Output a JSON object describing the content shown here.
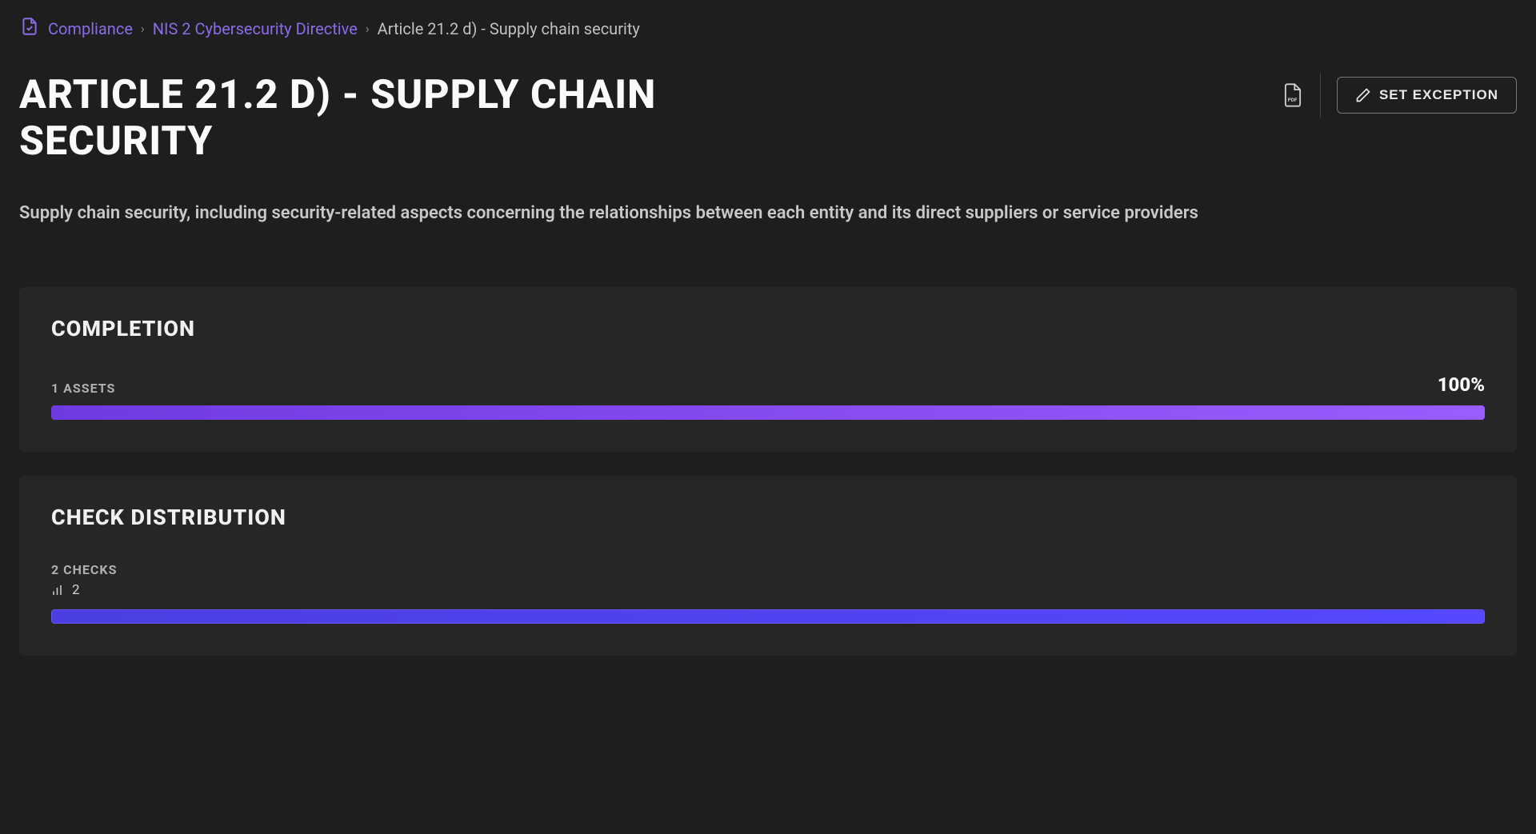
{
  "breadcrumb": {
    "root": "Compliance",
    "parent": "NIS 2 Cybersecurity Directive",
    "current": "Article 21.2 d) - Supply chain security"
  },
  "header": {
    "title": "ARTICLE 21.2 D) - SUPPLY CHAIN SECURITY",
    "set_exception_label": "SET EXCEPTION"
  },
  "description": "Supply chain security, including security-related aspects concerning the relationships between each entity and its direct suppliers or service providers",
  "completion": {
    "panel_title": "COMPLETION",
    "assets_label": "1 ASSETS",
    "percent": "100%",
    "percent_value": 100
  },
  "check_distribution": {
    "panel_title": "CHECK DISTRIBUTION",
    "checks_label": "2 CHECKS",
    "count": "2",
    "percent_value": 100
  },
  "colors": {
    "accent_purple": "#8b6be8",
    "progress_gradient_start": "#6f3be0",
    "progress_gradient_end": "#9a5cff",
    "dist_bar": "#4a3fe0"
  }
}
